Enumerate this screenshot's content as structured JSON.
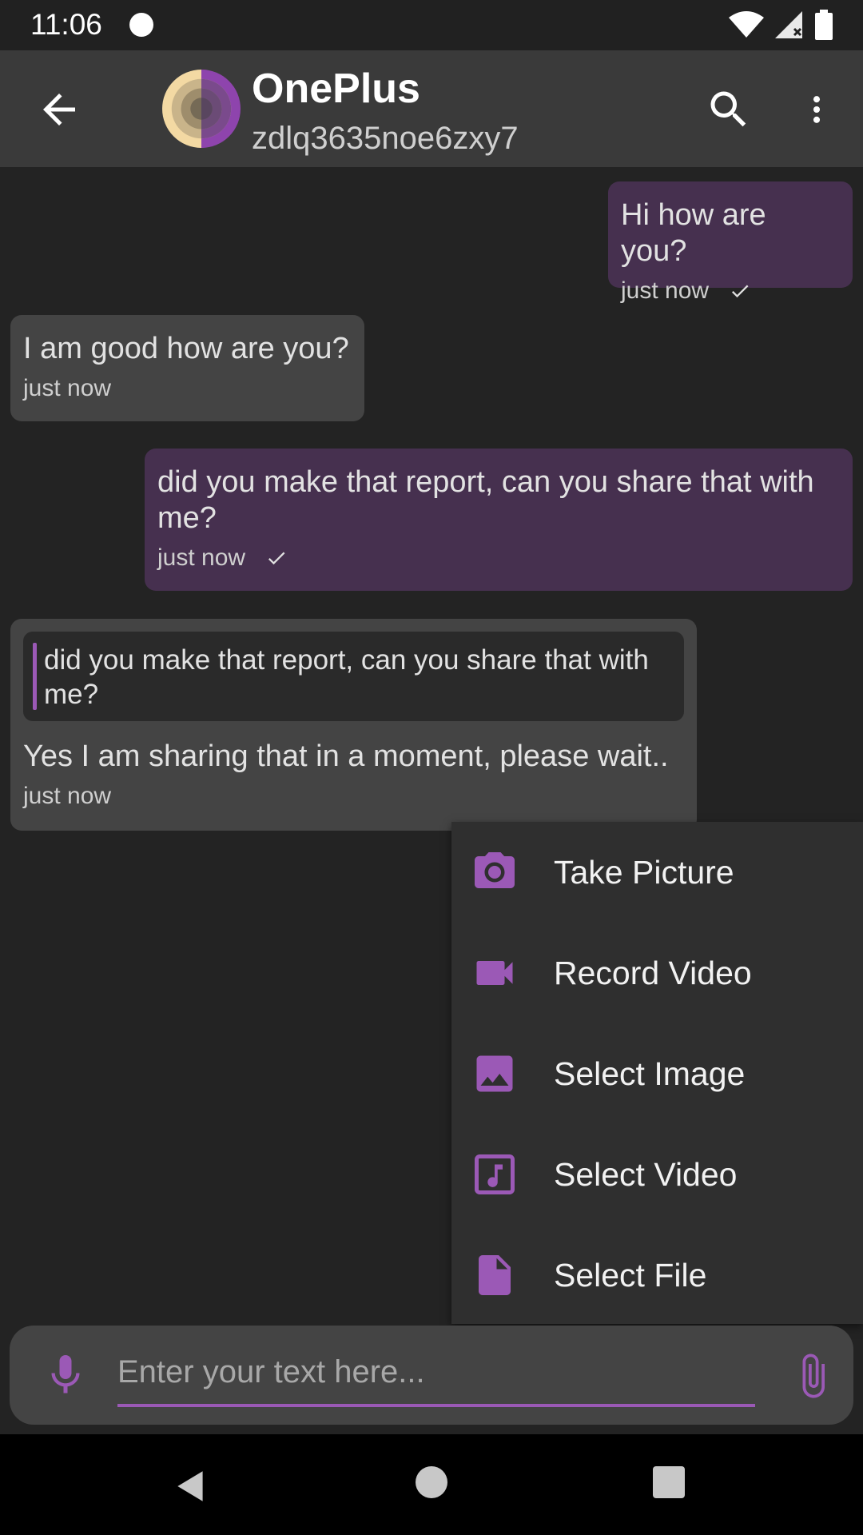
{
  "status_bar": {
    "time": "11:06"
  },
  "app_bar": {
    "title": "OnePlus",
    "subtitle": "zdlq3635noe6zxy7"
  },
  "messages": [
    {
      "direction": "outgoing",
      "text": "Hi how are you?",
      "time": "just now",
      "status": "sent"
    },
    {
      "direction": "incoming",
      "text": "I am good how are you?",
      "time": "just now"
    },
    {
      "direction": "outgoing",
      "text": "did you make that report, can you share that with me?",
      "time": "just now",
      "status": "sent"
    },
    {
      "direction": "incoming",
      "quoted": "did you make that report, can you share that with me?",
      "text": "Yes I am sharing that in a moment, please wait..",
      "time": "just now"
    }
  ],
  "attach_menu": {
    "items": [
      {
        "label": "Take Picture",
        "icon": "camera-icon"
      },
      {
        "label": "Record Video",
        "icon": "videocam-icon"
      },
      {
        "label": "Select Image",
        "icon": "image-icon"
      },
      {
        "label": "Select Video",
        "icon": "video-file-icon"
      },
      {
        "label": "Select File",
        "icon": "file-icon"
      }
    ]
  },
  "composer": {
    "placeholder": "Enter your text here...",
    "value": ""
  },
  "colors": {
    "accent": "#9b59b6",
    "outgoing_bubble": "#46304f",
    "incoming_bubble": "#444444",
    "app_bar": "#3a3a3a",
    "background": "#232323"
  }
}
